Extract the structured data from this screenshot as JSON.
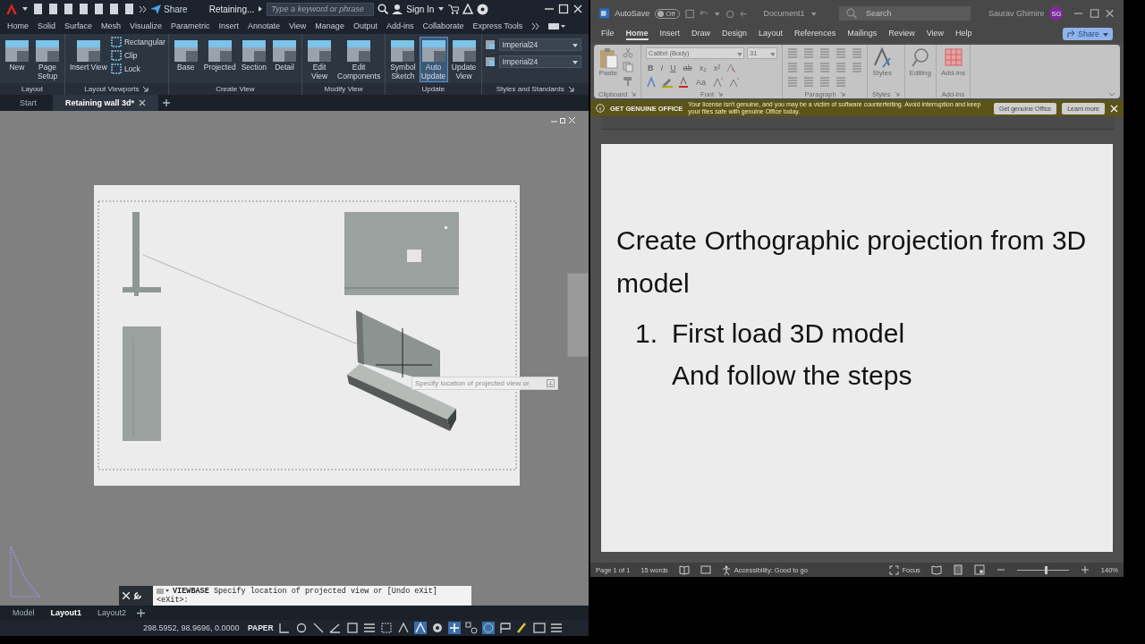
{
  "autocad": {
    "title_bar": {
      "share": "Share",
      "document": "Retaining...",
      "search_placeholder": "Type a keyword or phrase",
      "sign_in": "Sign In"
    },
    "tabs": [
      "Home",
      "Solid",
      "Surface",
      "Mesh",
      "Visualize",
      "Parametric",
      "Insert",
      "Annotate",
      "View",
      "Manage",
      "Output",
      "Add-ins",
      "Collaborate",
      "Express Tools"
    ],
    "ribbon": [
      {
        "title": "Layout",
        "tools": [
          {
            "kind": "large",
            "label": "New",
            "active": false
          },
          {
            "kind": "large",
            "label": "Page Setup",
            "active": false
          }
        ]
      },
      {
        "title": "Layout Viewports",
        "tools": [
          {
            "kind": "wide",
            "label": "Insert View",
            "active": false
          },
          {
            "kind": "small",
            "label": "Rectangular",
            "active": false
          },
          {
            "kind": "small",
            "label": "Clip",
            "active": false
          },
          {
            "kind": "small",
            "label": "Lock",
            "active": false
          }
        ]
      },
      {
        "title": "Create View",
        "tools": [
          {
            "kind": "large",
            "label": "Base",
            "active": false
          },
          {
            "kind": "large",
            "label": "Projected",
            "active": false
          },
          {
            "kind": "large",
            "label": "Section",
            "active": false
          },
          {
            "kind": "large",
            "label": "Detail",
            "active": false
          }
        ]
      },
      {
        "title": "Modify View",
        "tools": [
          {
            "kind": "large",
            "label": "Edit View",
            "active": false
          },
          {
            "kind": "large",
            "label": "Edit Components",
            "active": false
          }
        ]
      },
      {
        "title": "Update",
        "tools": [
          {
            "kind": "large",
            "label": "Symbol Sketch",
            "active": false
          },
          {
            "kind": "large",
            "label": "Auto Update",
            "active": true
          },
          {
            "kind": "large",
            "label": "Update View",
            "active": false
          }
        ]
      },
      {
        "title": "Styles and Standards",
        "tools": [
          {
            "kind": "select",
            "value": "Imperial24"
          },
          {
            "kind": "select",
            "value": "Imperial24"
          }
        ]
      }
    ],
    "file_tabs": [
      {
        "label": "Start",
        "selected": false
      },
      {
        "label": "Retaining wall 3d*",
        "selected": true
      }
    ],
    "tooltip": "Specify location of projected view or",
    "command_line": {
      "prompt": "**VIEWBASE** Specify location of projected view or [Undo eXit]",
      "default": "<eXit>:"
    },
    "layout_tabs": [
      {
        "label": "Model",
        "selected": false
      },
      {
        "label": "Layout1",
        "selected": true
      },
      {
        "label": "Layout2",
        "selected": false
      }
    ],
    "status_bar": {
      "coordinates": "298.5952, 98.9696, 0.0000",
      "space": "PAPER"
    }
  },
  "word": {
    "title_bar": {
      "autosave": "AutoSave",
      "autosave_on": false,
      "toggle": "Off",
      "document": "Document1",
      "search_placeholder": "Search",
      "user": "Saurav Ghimire",
      "initials": "SG"
    },
    "tabs": [
      {
        "label": "File",
        "selected": false
      },
      {
        "label": "Home",
        "selected": true
      },
      {
        "label": "Insert",
        "selected": false
      },
      {
        "label": "Draw",
        "selected": false
      },
      {
        "label": "Design",
        "selected": false
      },
      {
        "label": "Layout",
        "selected": false
      },
      {
        "label": "References",
        "selected": false
      },
      {
        "label": "Mailings",
        "selected": false
      },
      {
        "label": "Review",
        "selected": false
      },
      {
        "label": "View",
        "selected": false
      },
      {
        "label": "Help",
        "selected": false
      }
    ],
    "share": "Share",
    "ribbon": {
      "clipboard": {
        "paste": "Paste",
        "title": "Clipboard"
      },
      "font": {
        "name": "Calibri (Body)",
        "size": "31",
        "buttons": [
          "B",
          "I",
          "U",
          "ab",
          "x₂",
          "x²"
        ],
        "case": "Aa",
        "title": "Font"
      },
      "paragraph": {
        "title": "Paragraph"
      },
      "styles": {
        "label": "Styles",
        "title": "Styles"
      },
      "editing": {
        "label": "Editing"
      },
      "addins": {
        "label": "Add-ins",
        "title": "Add-ins"
      }
    },
    "banner": {
      "heading": "GET GENUINE OFFICE",
      "message": "Your license isn't genuine, and you may be a victim of software counterfeiting. Avoid interruption and keep your files safe with genuine Office today.",
      "buttons": [
        "Get genuine Office",
        "Learn more"
      ]
    },
    "document": {
      "heading": "Create Orthographic projection from 3D model",
      "list": [
        {
          "marker": "1.",
          "lines": [
            "First load 3D model",
            "And follow the steps"
          ]
        }
      ]
    },
    "status_bar": {
      "page": "Page 1 of 1",
      "words": "15 words",
      "accessibility": "Accessibility: Good to go",
      "focus": "Focus",
      "zoom": {
        "level": 0.55,
        "reading": "140%"
      }
    }
  }
}
